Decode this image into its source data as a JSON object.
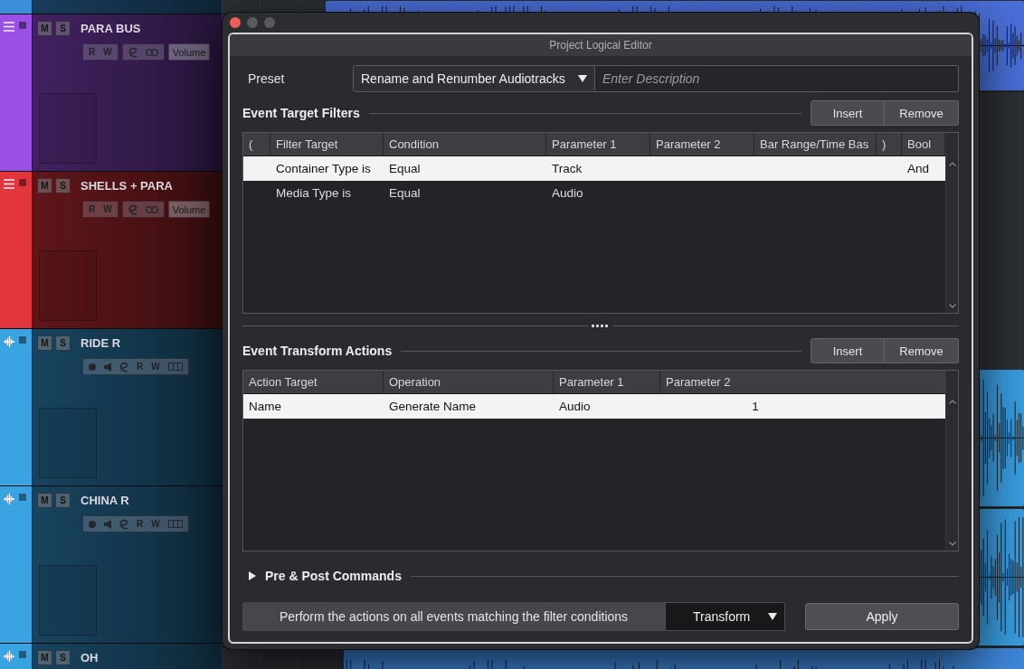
{
  "tracks": [
    {
      "color": "#3b8ed8"
    },
    {
      "name": "PARA BUS",
      "kind": "group",
      "color": "#9a50e4",
      "mute": "M",
      "solo": "S",
      "control_groups": [
        [
          {
            "kind": "text",
            "label": "R"
          },
          {
            "kind": "text",
            "label": "W"
          }
        ],
        [
          {
            "kind": "edit"
          },
          {
            "kind": "link"
          }
        ],
        [
          {
            "kind": "field",
            "label": "Volume"
          }
        ]
      ]
    },
    {
      "name": "SHELLS + PARA",
      "kind": "group",
      "color": "#e3353c",
      "mute": "M",
      "solo": "S",
      "control_groups": [
        [
          {
            "kind": "text",
            "label": "R"
          },
          {
            "kind": "text",
            "label": "W"
          }
        ],
        [
          {
            "kind": "edit"
          },
          {
            "kind": "link"
          }
        ],
        [
          {
            "kind": "field",
            "label": "Volume"
          }
        ]
      ]
    },
    {
      "name": "RIDE R",
      "kind": "audio",
      "color": "#3aa3e2",
      "mute": "M",
      "solo": "S",
      "control_groups": [
        [
          {
            "kind": "record"
          },
          {
            "kind": "monitor"
          },
          {
            "kind": "edit"
          },
          {
            "kind": "text",
            "label": "R"
          },
          {
            "kind": "text",
            "label": "W"
          },
          {
            "kind": "lanes"
          }
        ]
      ]
    },
    {
      "name": "CHINA R",
      "kind": "audio",
      "color": "#3aa3e2",
      "mute": "M",
      "solo": "S",
      "control_groups": [
        [
          {
            "kind": "record"
          },
          {
            "kind": "monitor"
          },
          {
            "kind": "edit"
          },
          {
            "kind": "text",
            "label": "R"
          },
          {
            "kind": "text",
            "label": "W"
          },
          {
            "kind": "lanes"
          }
        ]
      ]
    },
    {
      "name": "OH",
      "kind": "audio",
      "color": "#3aa3e2",
      "mute": "M",
      "solo": "S"
    }
  ],
  "arrange": {
    "events": [
      {
        "color": "#4a6fd9"
      },
      {
        "color": "#3a9ee2"
      },
      {
        "color": "#3a9ee2"
      },
      {
        "color": "#3f88dc"
      }
    ]
  },
  "dialog": {
    "title": "Project Logical Editor",
    "window_controls": [
      {
        "kind": "close",
        "disabled": false
      },
      {
        "kind": "minimize",
        "disabled": true
      },
      {
        "kind": "zoom",
        "disabled": true
      }
    ],
    "preset": {
      "label": "Preset",
      "value": "Rename and Renumber Audiotracks"
    },
    "description": {
      "placeholder": "Enter Description"
    },
    "filters": {
      "title": "Event Target Filters",
      "buttons": [
        {
          "kind": "insert",
          "label": "Insert"
        },
        {
          "kind": "remove",
          "label": "Remove"
        }
      ],
      "columns": [
        "(",
        "Filter Target",
        "Condition",
        "Parameter 1",
        "Parameter 2",
        "Bar Range/Time Bas",
        ")",
        "Bool"
      ],
      "rows": [
        {
          "selected": true,
          "filter_target": "Container Type is",
          "condition": "Equal",
          "parameter_1": "Track",
          "bool": "And"
        },
        {
          "selected": false,
          "filter_target": "Media Type is",
          "condition": "Equal",
          "parameter_1": "Audio"
        }
      ]
    },
    "actions": {
      "title": "Event Transform Actions",
      "buttons": [
        {
          "kind": "insert",
          "label": "Insert"
        },
        {
          "kind": "remove",
          "label": "Remove"
        }
      ],
      "columns": [
        "Action Target",
        "Operation",
        "Parameter 1",
        "Parameter 2"
      ],
      "rows": [
        {
          "selected": true,
          "action_target": "Name",
          "operation": "Generate Name",
          "parameter_1": "Audio",
          "parameter_2": "1"
        }
      ]
    },
    "pre_post": {
      "title": "Pre & Post Commands",
      "expanded": false
    },
    "footer": {
      "caption": "Perform the actions on all events matching the filter conditions",
      "mode": "Transform",
      "apply": "Apply"
    }
  }
}
